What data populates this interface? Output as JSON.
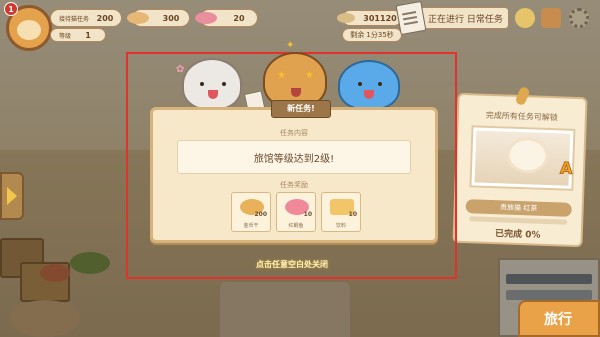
{
  "hud": {
    "level_badge": "1",
    "guild_label": "接待猫任务",
    "guild_value": "200",
    "likes_label": "等级",
    "likes_value": "1",
    "coins": "300",
    "fish": "20",
    "cash": "301120",
    "timer": "剩余 1分35秒",
    "task_button": "正在进行 日常任务"
  },
  "dialog": {
    "tab_title": "新任务!",
    "subtitle": "任务内容",
    "task_text": "旅馆等级达到2级!",
    "reward_label": "任务奖励",
    "rewards": [
      {
        "name": "金币干",
        "count": "200",
        "color": "#e8b15a"
      },
      {
        "name": "红鲷鱼",
        "count": "10",
        "color": "#f08a9a"
      },
      {
        "name": "饮料",
        "count": "10",
        "color": "#f3c569"
      }
    ],
    "close_hint": "点击任意空白处关闭"
  },
  "unlock": {
    "title": "完成所有任务可解锁",
    "grade": "A",
    "name": "贵族猫 红茶",
    "progress_percent": 0,
    "progress_text": "已完成 0%"
  },
  "travel_button": "旅行",
  "colors": {
    "highlight_border": "#e3322b",
    "accent_gold": "#f4a52b"
  }
}
